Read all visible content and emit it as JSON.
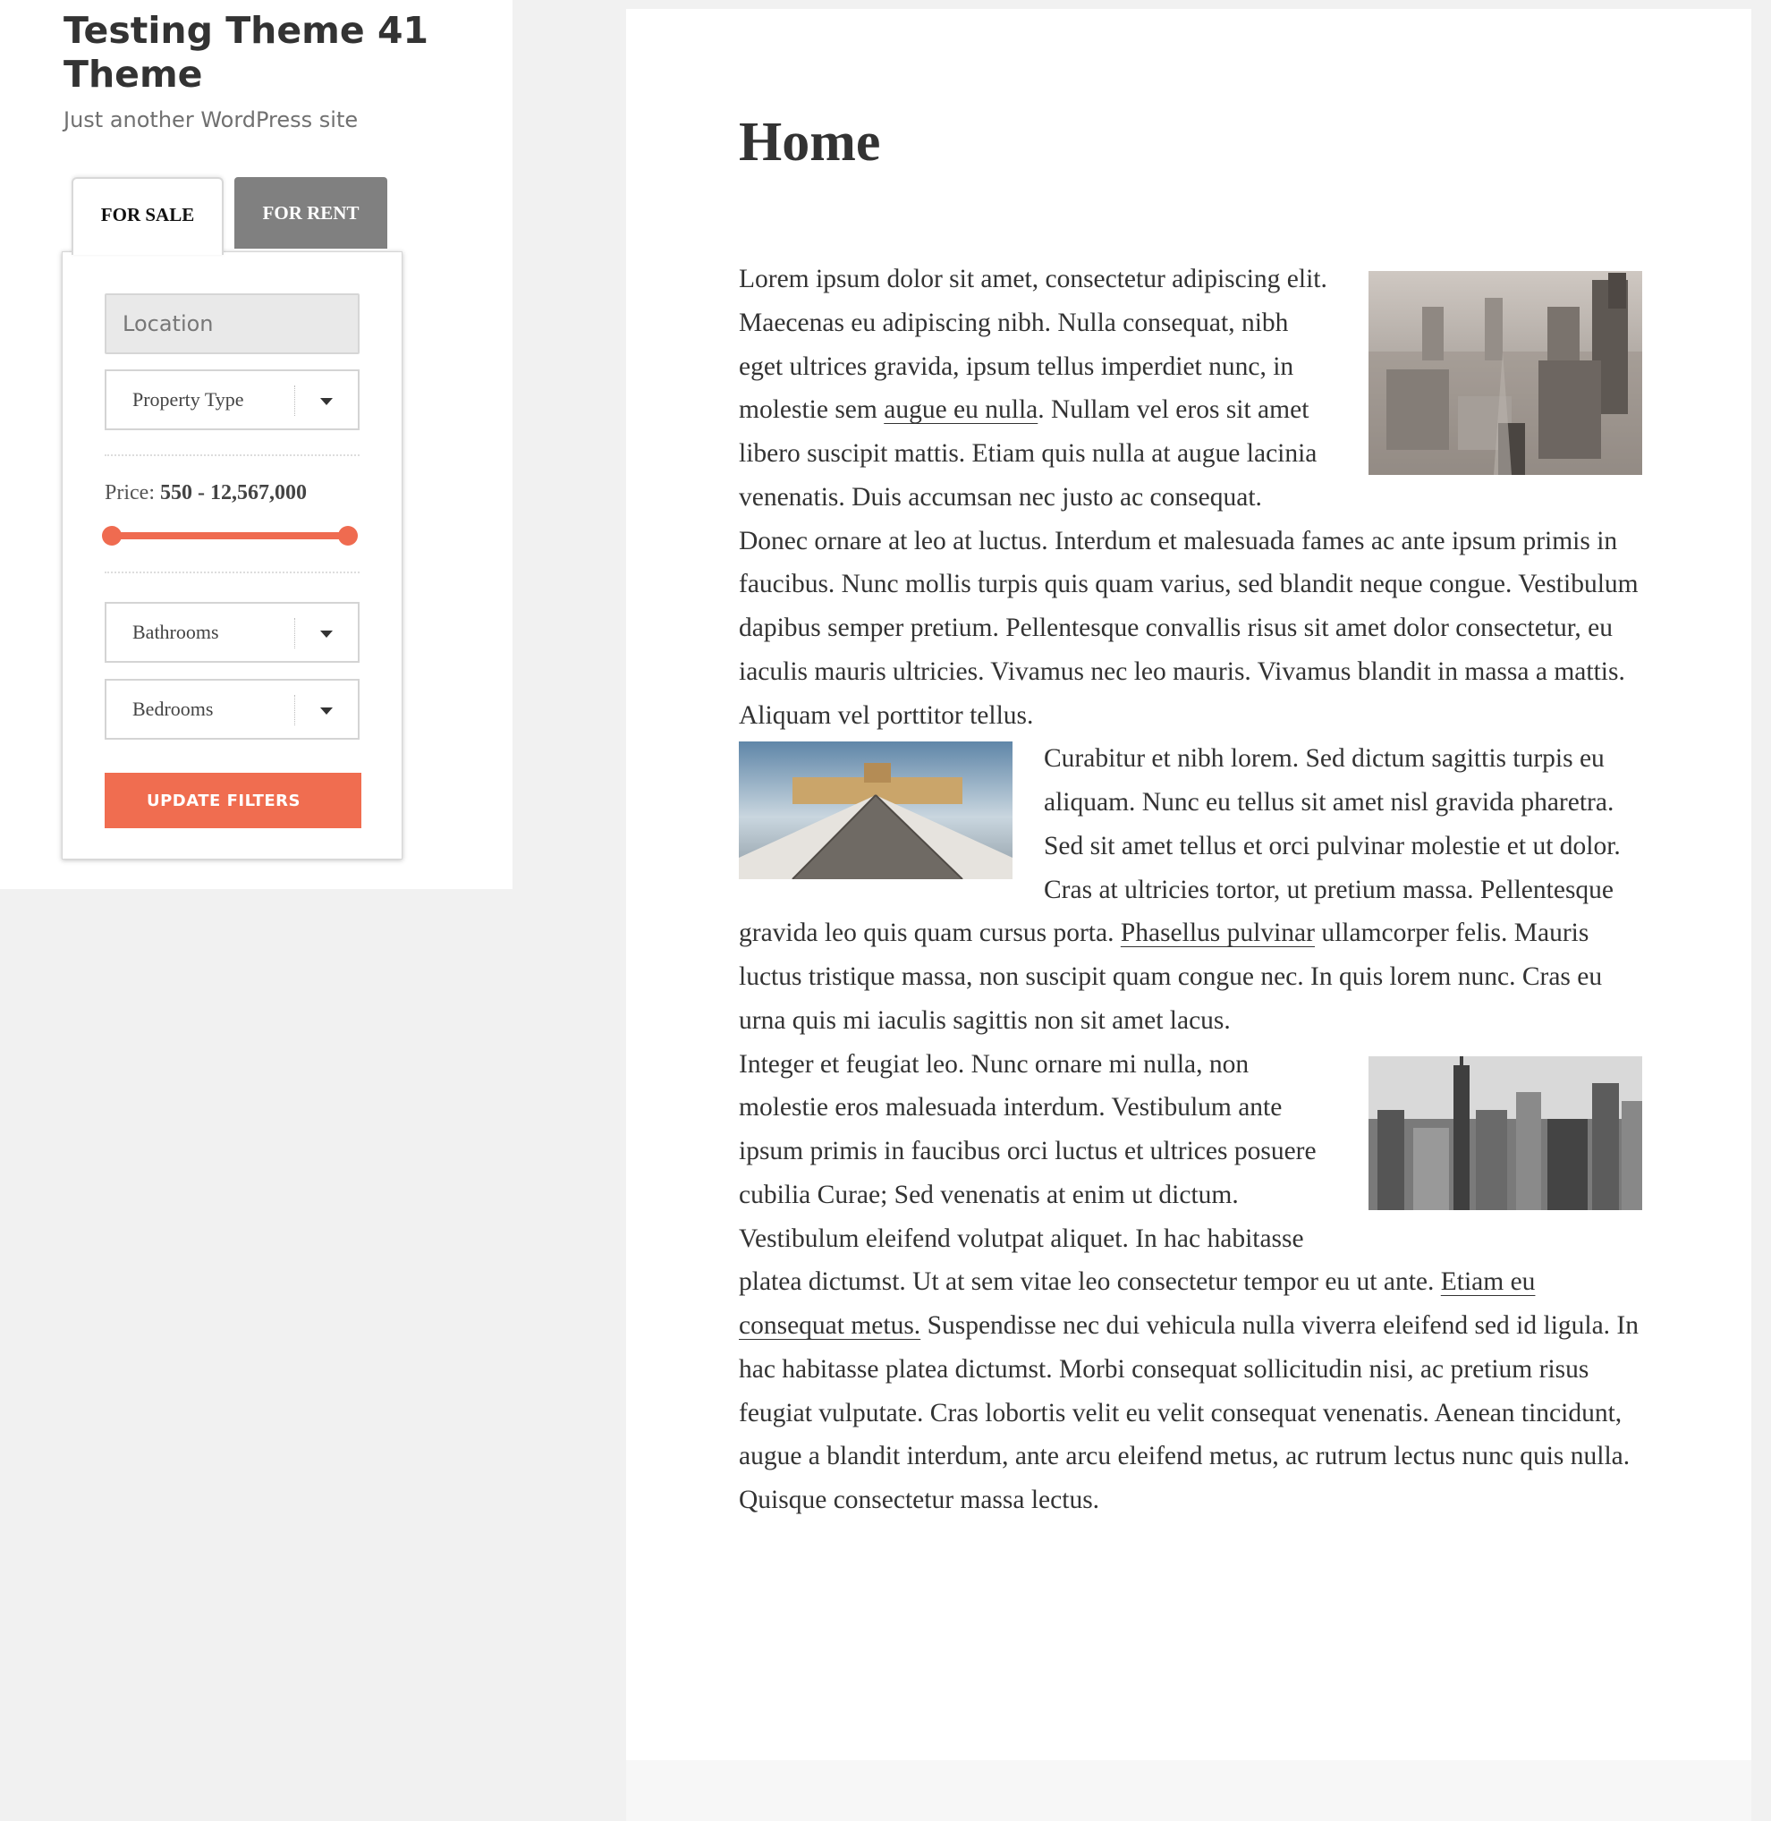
{
  "site": {
    "title": "Testing Theme 41 Theme",
    "description": "Just another WordPress site"
  },
  "search_widget": {
    "tabs": [
      {
        "label": "FOR SALE",
        "active": true
      },
      {
        "label": "FOR RENT",
        "active": false
      }
    ],
    "location_placeholder": "Location",
    "property_type_label": "Property Type",
    "price_label": "Price:",
    "price_range_text": "550 - 12,567,000",
    "price_slider": {
      "min": 550,
      "max": 12567000,
      "low": 550,
      "high": 12567000
    },
    "bathrooms_label": "Bathrooms",
    "bedrooms_label": "Bedrooms",
    "update_button_label": "UPDATE FILTERS",
    "accent_color": "#f06d50"
  },
  "page": {
    "title": "Home",
    "p1": {
      "a": "Lorem ipsum dolor sit amet, consectetur adipiscing elit. Maecenas eu adipiscing nibh. Nulla consequat, nibh eget ultrices gravida, ipsum tellus imperdiet nunc, in molestie sem ",
      "link": "augue eu nulla",
      "b": ". Nullam vel eros sit amet libero suscipit mattis. Etiam quis nulla at augue lacinia venenatis. Duis accumsan nec justo ac consequat. Donec ornare at leo at luctus. Interdum et malesuada fames ac ante ipsum primis in faucibus. Nunc mollis turpis quis quam varius, sed blandit neque congue. Vestibulum dapibus semper pretium. Pellentesque convallis risus sit amet dolor consectetur, eu iaculis mauris ultricies. Vivamus nec leo mauris. Vivamus blandit in massa a mattis. Aliquam vel porttitor tellus."
    },
    "p2": {
      "a": "Curabitur et nibh lorem. Sed dictum sagittis turpis eu aliquam. Nunc eu tellus sit amet nisl gravida pharetra. Sed sit amet tellus et orci pulvinar molestie et ut dolor. Cras at ultricies tortor, ut pretium massa. Pellentesque gravida leo quis quam cursus porta. ",
      "link": "Phasellus pulvinar",
      "b": " ullamcorper felis. Mauris luctus tristique massa, non suscipit quam congue nec. In quis lorem nunc. Cras eu urna quis mi iaculis sagittis non sit amet lacus."
    },
    "p3": {
      "a": "Integer et feugiat leo. Nunc ornare mi nulla, non molestie eros malesuada interdum. Vestibulum ante ipsum primis in faucibus orci luctus et ultrices posuere cubilia Curae; Sed venenatis at enim ut dictum. Vestibulum eleifend volutpat aliquet. In hac habitasse platea dictumst. Ut at sem vitae leo consectetur tempor eu ut ante. ",
      "link": "Etiam eu consequat metus.",
      "b": " Suspendisse nec dui vehicula nulla viverra eleifend sed id ligula. In hac habitasse platea dictumst. Morbi consequat sollicitudin nisi, ac pretium risus feugiat vulputate. Cras lobortis velit eu velit consequat venenatis. Aenean tincidunt, augue a blandit interdum, ante arcu eleifend metus, ac rutrum lectus nunc quis nulla. Quisque consectetur massa lectus."
    }
  }
}
